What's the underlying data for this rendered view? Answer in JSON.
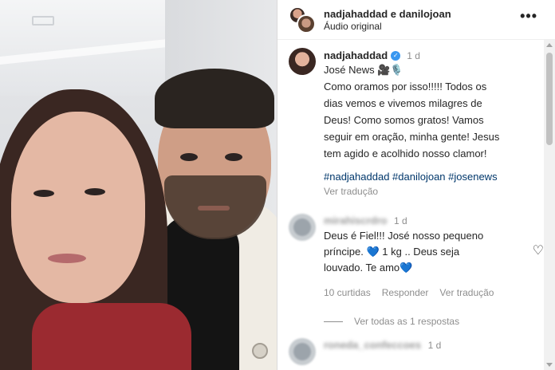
{
  "header": {
    "title": "nadjahaddad e danilojoan",
    "subtitle": "Áudio original",
    "more_icon": "more-horizontal-icon"
  },
  "caption": {
    "username": "nadjahaddad",
    "verified_icon": "verified-badge-icon",
    "time": "1 d",
    "first_line_text": "José News 🎥🎙️",
    "lines": [
      "Como oramos por isso!!!!! Todos os",
      "dias vemos e vivemos milagres de",
      "Deus! Como somos gratos! Vamos",
      "seguir em oração, minha gente! Jesus",
      "tem agido e acolhido nosso clamor!"
    ],
    "hashtags": "#nadjahaddad #danilojoan #josenews",
    "translate": "Ver tradução"
  },
  "comment1": {
    "username": "mirahiscrdro",
    "time": "1 d",
    "line1": "Deus é Fiel!!! José nosso pequeno",
    "line2_prefix": "príncipe. ",
    "heart1": "💙",
    "line2_suffix": " 1 kg .. Deus seja",
    "line3_prefix": "louvado. Te amo",
    "heart2": "💙",
    "likes": "10 curtidas",
    "reply": "Responder",
    "translate": "Ver tradução",
    "view_replies": "Ver todas as 1 respostas",
    "like_icon": "heart-outline-icon"
  },
  "comment2": {
    "username": "roneda_confeccoes",
    "time": "1 d"
  },
  "colors": {
    "link": "#00376b",
    "muted": "#8e8e8e",
    "verified": "#3897f0"
  }
}
